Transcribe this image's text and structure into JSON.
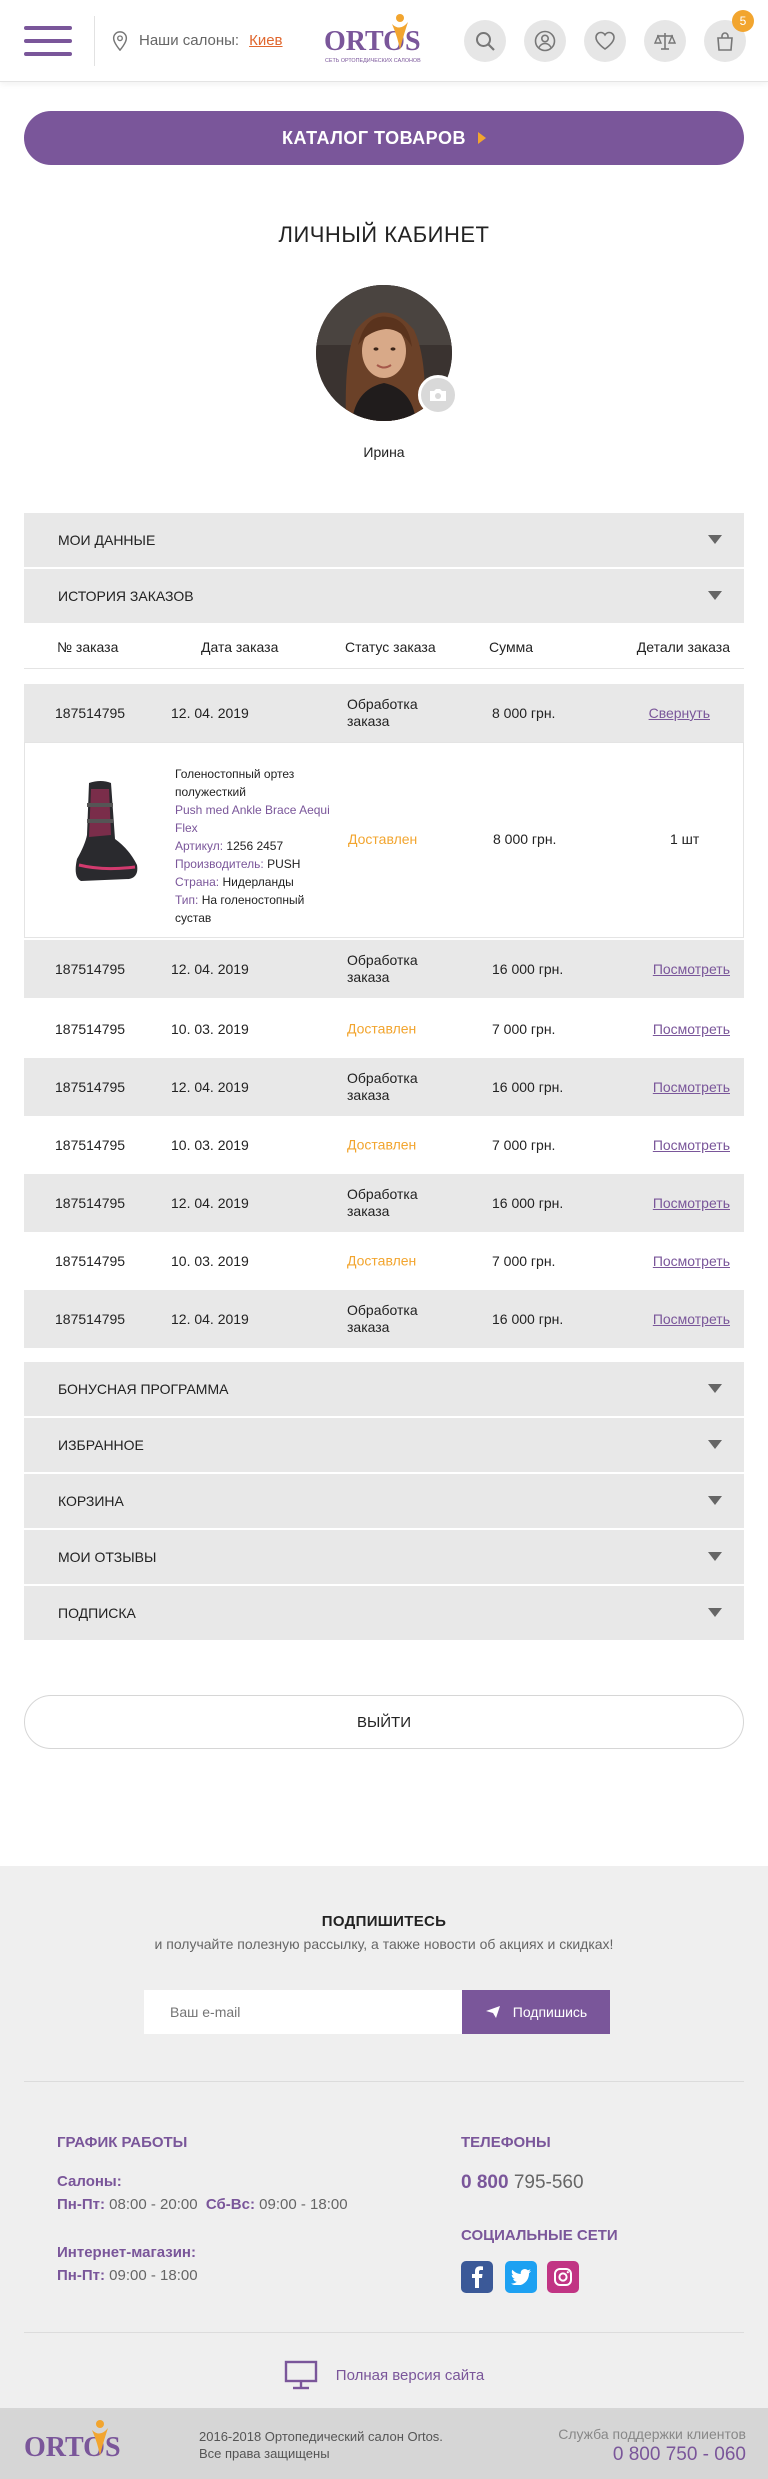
{
  "header": {
    "salons_label": "Наши салоны:",
    "city": "Киев",
    "logo_text": "ORTOS",
    "logo_tagline": "СЕТЬ ОРТОПЕДИЧЕСКИХ САЛОНОВ",
    "cart_count": "5",
    "icons": [
      "menu-icon",
      "location-pin-icon",
      "search-icon",
      "user-icon",
      "heart-icon",
      "scales-icon",
      "cart-icon"
    ]
  },
  "catalog_button": "КАТАЛОГ ТОВАРОВ",
  "page_title": "ЛИЧНЫЙ КАБИНЕТ",
  "user": {
    "name": "Ирина"
  },
  "sections": {
    "my_data": "МОИ ДАННЫЕ",
    "order_history": "ИСТОРИЯ ЗАКАЗОВ",
    "bonus": "БОНУСНАЯ ПРОГРАММА",
    "favorites": "ИЗБРАННОЕ",
    "cart": "КОРЗИНА",
    "reviews": "МОИ ОТЗЫВЫ",
    "subscription": "ПОДПИСКА"
  },
  "orders": {
    "columns": [
      "№ заказа",
      "Дата заказа",
      "Статус заказа",
      "Сумма",
      "Детали заказа"
    ],
    "rows": [
      {
        "id": "187514795",
        "date": "12. 04. 2019",
        "status": "Обработка заказа",
        "sum": "8 000 грн.",
        "action": "Свернуть"
      },
      {
        "id": "187514795",
        "date": "12. 04. 2019",
        "status": "Обработка заказа",
        "sum": "16 000 грн.",
        "action": "Посмотреть"
      },
      {
        "id": "187514795",
        "date": "10. 03. 2019",
        "status": "Доставлен",
        "sum": "7 000 грн.",
        "action": "Посмотреть"
      },
      {
        "id": "187514795",
        "date": "12. 04. 2019",
        "status": "Обработка заказа",
        "sum": "16 000 грн.",
        "action": "Посмотреть"
      },
      {
        "id": "187514795",
        "date": "10. 03. 2019",
        "status": "Доставлен",
        "sum": "7 000 грн.",
        "action": "Посмотреть"
      },
      {
        "id": "187514795",
        "date": "12. 04. 2019",
        "status": "Обработка заказа",
        "sum": "16 000 грн.",
        "action": "Посмотреть"
      },
      {
        "id": "187514795",
        "date": "10. 03. 2019",
        "status": "Доставлен",
        "sum": "7 000 грн.",
        "action": "Посмотреть"
      },
      {
        "id": "187514795",
        "date": "12. 04. 2019",
        "status": "Обработка заказа",
        "sum": "16 000 грн.",
        "action": "Посмотреть"
      }
    ],
    "detail": {
      "name": "Голеностопный ортез полужесткий",
      "model": "Push med Ankle Brace Aequi Flex",
      "article_label": "Артикул:",
      "article": "1256 2457",
      "maker_label": "Производитель:",
      "maker": "PUSH",
      "country_label": "Страна:",
      "country": "Нидерланды",
      "type_label": "Тип:",
      "type": "На голеностопный сустав",
      "status": "Доставлен",
      "sum": "8 000 грн.",
      "qty": "1 шт"
    }
  },
  "logout": "ВЫЙТИ",
  "footer": {
    "subscribe_title": "ПОДПИШИТЕСЬ",
    "subscribe_text": "и получайте полезную рассылку, а также новости об акциях и скидках!",
    "email_placeholder": "Ваш e-mail",
    "subscribe_button": "Подпишись",
    "schedule_title": "ГРАФИК РАБОТЫ",
    "salons_label": "Салоны:",
    "weekdays_label": "Пн-Пт:",
    "weekdays_hours": "08:00 - 20:00",
    "weekend_label": "Сб-Вс:",
    "weekend_hours": "09:00 - 18:00",
    "online_label": "Интернет-магазин:",
    "online_days": "Пн-Пт:",
    "online_hours": "09:00 - 18:00",
    "phones_title": "ТЕЛЕФОНЫ",
    "phone_code": "0 800",
    "phone_number": "795-560",
    "social_title": "СОЦИАЛЬНЫЕ СЕТИ",
    "full_version": "Полная версия сайта",
    "copyright_line1": "2016-2018  Ортопедический салон Ortos.",
    "copyright_line2": "Все права защищены",
    "support_label": "Служба поддержки клиентов",
    "support_phone": "0 800 750 - 060"
  },
  "colors": {
    "brand": "#7a569a",
    "accent": "#f2a52f",
    "city": "#e0672e",
    "panel": "#e8e8e8"
  }
}
